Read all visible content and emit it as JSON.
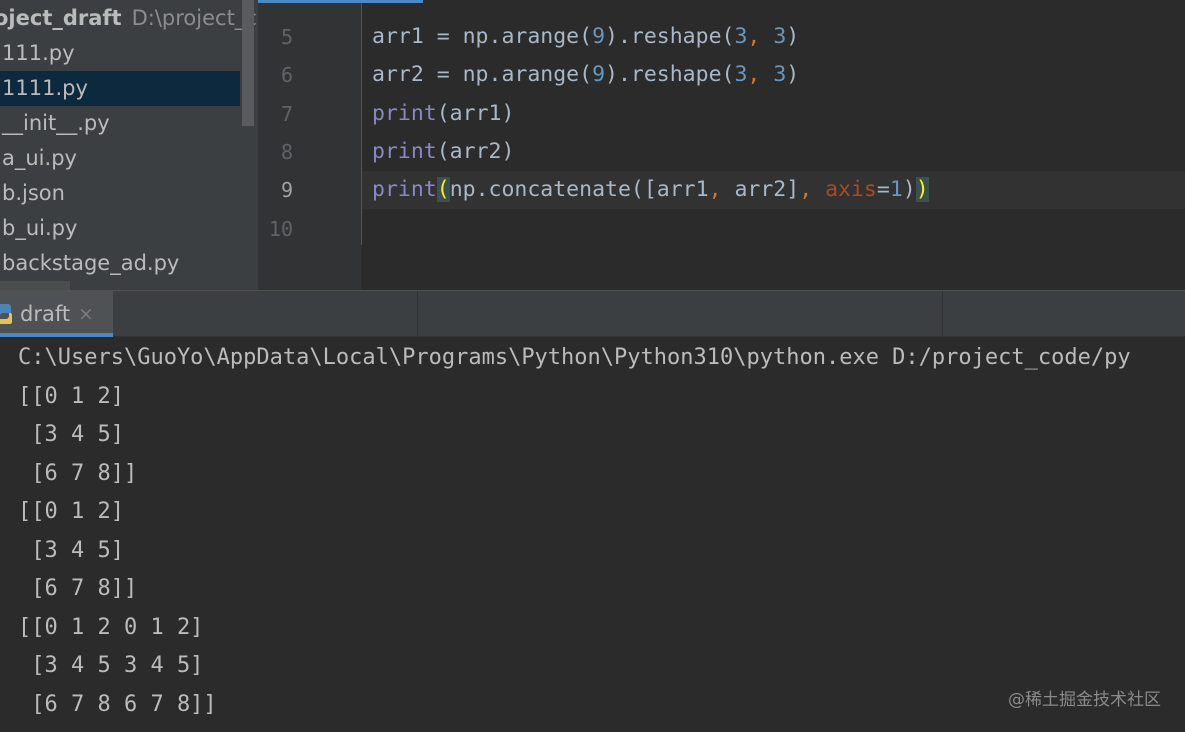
{
  "project": {
    "root_name": "oject_draft",
    "root_path": "D:\\project_cod",
    "files": [
      {
        "label": "111.py"
      },
      {
        "label": "1111.py",
        "selected": true
      },
      {
        "label": "__init__.py"
      },
      {
        "label": "a_ui.py"
      },
      {
        "label": "b.json"
      },
      {
        "label": "b_ui.py"
      },
      {
        "label": "backstage_ad.py"
      }
    ]
  },
  "editor": {
    "line_numbers": [
      "5",
      "6",
      "7",
      "8",
      "9",
      "10"
    ],
    "current_line": "9",
    "lines": [
      {
        "tokens": [
          {
            "t": "arr1 = np.arange(",
            "c": "plain"
          },
          {
            "t": "9",
            "c": "num"
          },
          {
            "t": ").reshape(",
            "c": "plain"
          },
          {
            "t": "3",
            "c": "num"
          },
          {
            "t": ", ",
            "c": "com"
          },
          {
            "t": "3",
            "c": "num"
          },
          {
            "t": ")",
            "c": "plain"
          }
        ]
      },
      {
        "tokens": [
          {
            "t": "arr2 = np.arange(",
            "c": "plain"
          },
          {
            "t": "9",
            "c": "num"
          },
          {
            "t": ").reshape(",
            "c": "plain"
          },
          {
            "t": "3",
            "c": "num"
          },
          {
            "t": ", ",
            "c": "com"
          },
          {
            "t": "3",
            "c": "num"
          },
          {
            "t": ")",
            "c": "plain"
          }
        ]
      },
      {
        "tokens": [
          {
            "t": "print",
            "c": "kw"
          },
          {
            "t": "(arr1)",
            "c": "plain"
          }
        ]
      },
      {
        "tokens": [
          {
            "t": "print",
            "c": "kw"
          },
          {
            "t": "(arr2)",
            "c": "plain"
          }
        ]
      },
      {
        "tokens": [
          {
            "t": "print",
            "c": "kw"
          },
          {
            "t": "(",
            "c": "brace-match"
          },
          {
            "t": "np.concatenate([arr1",
            "c": "plain"
          },
          {
            "t": ", ",
            "c": "com"
          },
          {
            "t": "arr2]",
            "c": "plain"
          },
          {
            "t": ", ",
            "c": "com"
          },
          {
            "t": "axis",
            "c": "param"
          },
          {
            "t": "=",
            "c": "plain"
          },
          {
            "t": "1",
            "c": "num"
          },
          {
            "t": ")",
            "c": "plain"
          },
          {
            "t": ")",
            "c": "brace-match"
          }
        ]
      },
      {
        "tokens": []
      }
    ]
  },
  "run": {
    "tab_label": "draft",
    "tab_close": "×",
    "output": [
      "C:\\Users\\GuoYo\\AppData\\Local\\Programs\\Python\\Python310\\python.exe D:/project_code/py",
      "[[0 1 2]",
      " [3 4 5]",
      " [6 7 8]]",
      "[[0 1 2]",
      " [3 4 5]",
      " [6 7 8]]",
      "[[0 1 2 0 1 2]",
      " [3 4 5 3 4 5]",
      " [6 7 8 6 7 8]]"
    ]
  },
  "watermark": "@稀土掘金技术社区",
  "colors": {
    "background": "#2b2b2b",
    "panel": "#3c3f41",
    "selection": "#0d293e",
    "accent": "#4a88c7",
    "keyword": "#8888c6",
    "number": "#6897bb",
    "comma": "#cc7832",
    "param": "#aa4926",
    "brace_match": "#ffef28"
  },
  "icons": {
    "run_tab_icon": "python-icon",
    "close_tab_icon": "close-icon"
  }
}
